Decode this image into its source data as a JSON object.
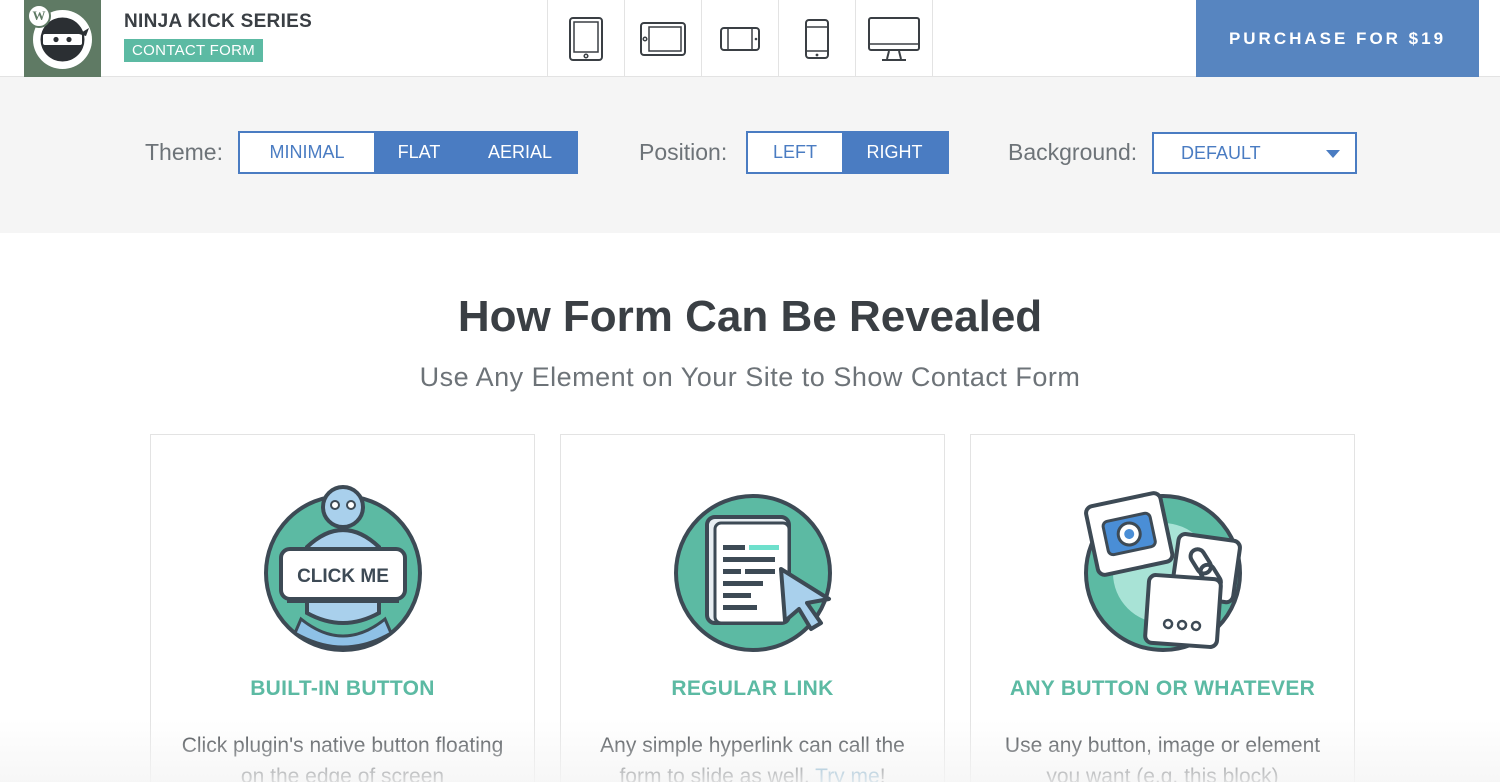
{
  "header": {
    "logo_badge": "W",
    "brand_title": "NINJA KICK SERIES",
    "brand_badge": "CONTACT FORM",
    "devices": [
      "tablet-portrait-icon",
      "tablet-landscape-icon",
      "phone-landscape-icon",
      "phone-portrait-icon",
      "desktop-icon"
    ],
    "purchase_label": "PURCHASE FOR $19"
  },
  "options": {
    "theme_label": "Theme:",
    "theme_options": [
      "MINIMAL",
      "FLAT",
      "AERIAL"
    ],
    "position_label": "Position:",
    "position_options": [
      "LEFT",
      "RIGHT"
    ],
    "background_label": "Background:",
    "background_value": "DEFAULT"
  },
  "main": {
    "title": "How Form Can Be Revealed",
    "subtitle": "Use Any Element on Your Site to Show Contact Form",
    "cards": [
      {
        "title": "BUILT-IN BUTTON",
        "illus_label": "CLICK ME",
        "text": "Click plugin's native button floating on the edge of screen",
        "icon": "click-me-button-icon"
      },
      {
        "title": "REGULAR LINK",
        "text_before": "Any simple hyperlink can call the form to slide as well. ",
        "link": "Try me",
        "text_after": "!",
        "icon": "document-cursor-icon"
      },
      {
        "title": "ANY BUTTON OR WHATEVER",
        "text": "Use any button, image or element you want (e.g. this block)",
        "icon": "camera-link-dots-icon"
      }
    ]
  },
  "colors": {
    "accent_blue": "#4a7cc2",
    "purchase_blue": "#5785c0",
    "teal": "#5cbaa3",
    "logo_green": "#5f7a64"
  }
}
